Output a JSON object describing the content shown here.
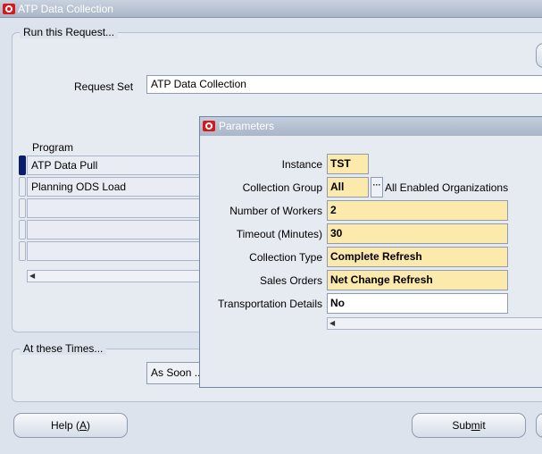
{
  "window": {
    "title": "ATP Data Collection"
  },
  "run_section": {
    "legend": "Run this Request...",
    "request_set_label": "Request Set",
    "request_set_value": "ATP Data Collection",
    "program_header": "Program",
    "programs": [
      {
        "name": "ATP Data Pull",
        "selected": true
      },
      {
        "name": "Planning ODS Load",
        "selected": false
      },
      {
        "name": "",
        "selected": false
      },
      {
        "name": "",
        "selected": false
      },
      {
        "name": "",
        "selected": false
      }
    ]
  },
  "times_section": {
    "legend": "At these Times...",
    "schedule_value": "As Soon ..."
  },
  "buttons": {
    "help_label": "Help (",
    "help_mnemonic": "A",
    "help_suffix": ")",
    "submit_pre": "Sub",
    "submit_mnemonic": "m",
    "submit_post": "it"
  },
  "parameters_dialog": {
    "title": "Parameters",
    "fields": [
      {
        "label": "Instance",
        "value": "TST"
      },
      {
        "label": "Collection Group",
        "value": "All",
        "description": "All Enabled Organizations"
      },
      {
        "label": "Number of Workers",
        "value": "2"
      },
      {
        "label": "Timeout (Minutes)",
        "value": "30"
      },
      {
        "label": "Collection Type",
        "value": "Complete Refresh"
      },
      {
        "label": "Sales Orders",
        "value": "Net Change Refresh"
      },
      {
        "label": "Transportation Details",
        "value": "No"
      }
    ]
  },
  "colors": {
    "required_field": "#fce9ac",
    "selected_row_marker": "#0b1d6e",
    "oracle_icon": "#d8191c"
  }
}
